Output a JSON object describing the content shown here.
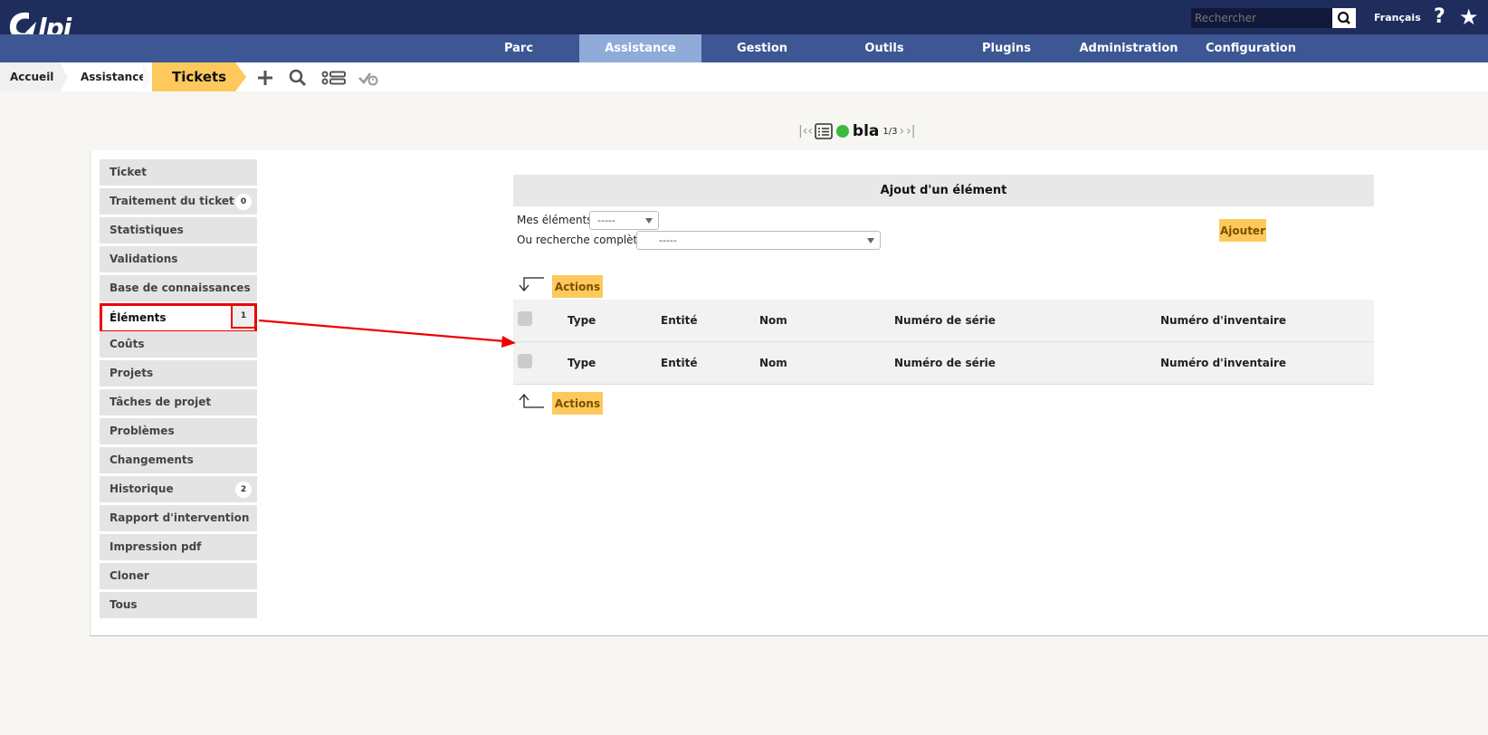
{
  "header": {
    "logo_text": "Glpi",
    "search_placeholder": "Rechercher",
    "language": "Français",
    "help_icon": "question-icon",
    "favorite_icon": "star-icon"
  },
  "menu": {
    "items": [
      {
        "label": "Parc"
      },
      {
        "label": "Assistance"
      },
      {
        "label": "Gestion"
      },
      {
        "label": "Outils"
      },
      {
        "label": "Plugins"
      },
      {
        "label": "Administration"
      },
      {
        "label": "Configuration"
      }
    ],
    "active": "Assistance"
  },
  "breadcrumb": {
    "home": "Accueil",
    "section": "Assistance",
    "current": "Tickets"
  },
  "toolbar": {
    "icons": [
      "add-icon",
      "search-icon",
      "list-icon",
      "validate-icon"
    ]
  },
  "record_nav": {
    "name": "bla",
    "position": "1/3",
    "status_color": "#3cba3f"
  },
  "tabs": [
    {
      "label": "Ticket",
      "badge": ""
    },
    {
      "label": "Traitement du ticket",
      "badge": "0"
    },
    {
      "label": "Statistiques",
      "badge": ""
    },
    {
      "label": "Validations",
      "badge": ""
    },
    {
      "label": "Base de connaissances",
      "badge": ""
    },
    {
      "label": "Éléments",
      "badge": "1"
    },
    {
      "label": "Coûts",
      "badge": ""
    },
    {
      "label": "Projets",
      "badge": ""
    },
    {
      "label": "Tâches de projet",
      "badge": ""
    },
    {
      "label": "Problèmes",
      "badge": ""
    },
    {
      "label": "Changements",
      "badge": ""
    },
    {
      "label": "Historique",
      "badge": "2"
    },
    {
      "label": "Rapport d'intervention",
      "badge": ""
    },
    {
      "label": "Impression pdf",
      "badge": ""
    },
    {
      "label": "Cloner",
      "badge": ""
    },
    {
      "label": "Tous",
      "badge": ""
    }
  ],
  "selected_tab": "Éléments",
  "add_item": {
    "title": "Ajout d'un élément",
    "my_items_label": "Mes éléments",
    "my_items_value": "-----",
    "full_search_label": "Ou recherche complète",
    "full_search_value": "-----",
    "add_button": "Ajouter"
  },
  "actions_label": "Actions",
  "table": {
    "columns": [
      "Type",
      "Entité",
      "Nom",
      "Numéro de série",
      "Numéro d'inventaire"
    ]
  },
  "colors": {
    "topbar": "#1f2d5c",
    "menubar": "#3c5793",
    "menu_active": "#8fabd9",
    "accent_yellow": "#fec95c",
    "annotation_red": "#e00000"
  }
}
